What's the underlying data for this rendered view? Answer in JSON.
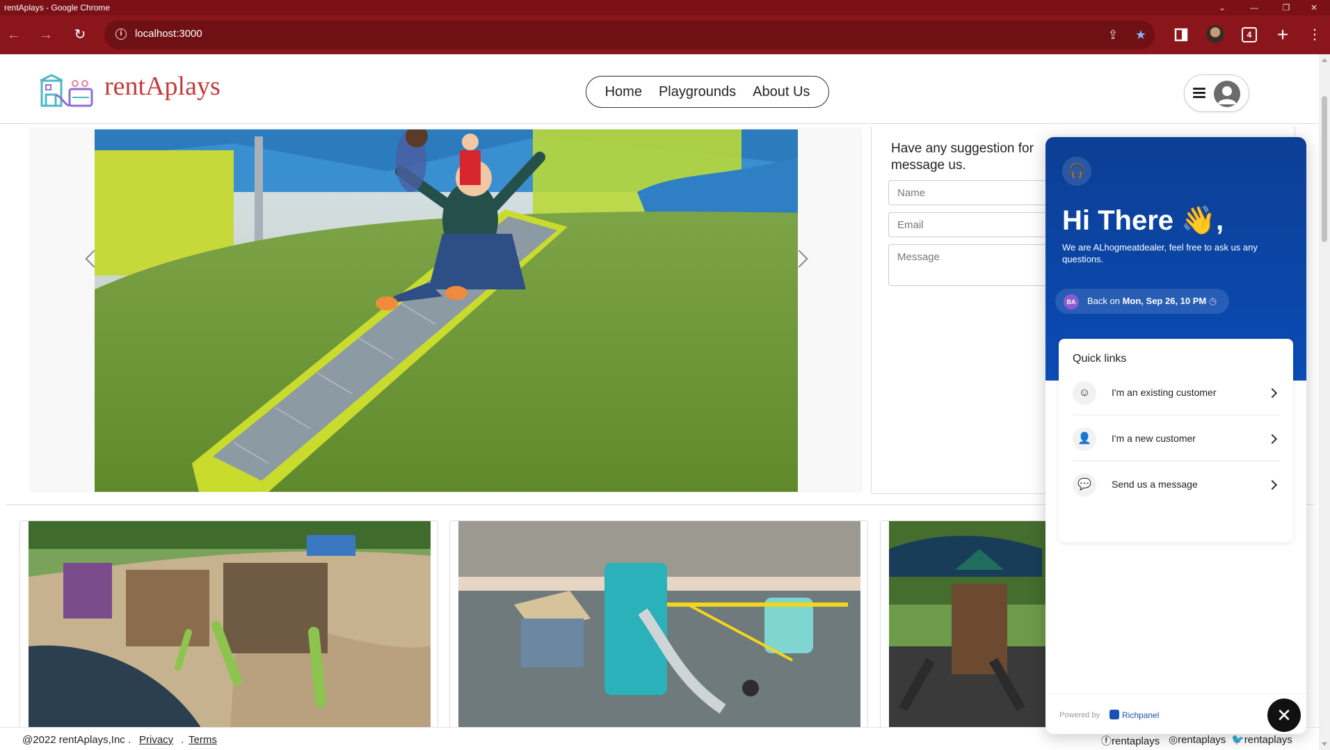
{
  "window": {
    "title": "rentAplays - Google Chrome"
  },
  "browser": {
    "url": "localhost:3000",
    "tab_count": "4"
  },
  "header": {
    "brand": "rentAplays",
    "nav": [
      "Home",
      "Playgrounds",
      "About Us"
    ]
  },
  "contact": {
    "title_line1": "Have any suggestion for",
    "title_line2": "message us.",
    "name_placeholder": "Name",
    "email_placeholder": "Email",
    "message_placeholder": "Message"
  },
  "footer": {
    "copyright": "@2022 rentAplays,Inc .",
    "privacy": "Privacy",
    "terms": "Terms",
    "sep": ".",
    "social": [
      {
        "icon": "facebook-icon",
        "label": "rentaplays"
      },
      {
        "icon": "instagram-icon",
        "label": "rentaplays"
      },
      {
        "icon": "twitter-icon",
        "label": "rentaplays"
      }
    ]
  },
  "chat": {
    "greeting": "Hi There 👋,",
    "subtitle": "We are ALhogmeatdealer, feel free to ask us any questions.",
    "badge": "BA",
    "back_prefix": "Back on ",
    "back_time": "Mon, Sep 26, 10 PM",
    "quick_links_title": "Quick links",
    "quick_links": [
      {
        "icon": "customer-face-icon",
        "label": "I'm an existing customer"
      },
      {
        "icon": "person-icon",
        "label": "I'm a new customer"
      },
      {
        "icon": "message-icon",
        "label": "Send us a message"
      }
    ],
    "powered_by": "Powered by",
    "provider": "Richpanel"
  },
  "colors": {
    "chrome_frame": "#7b1116",
    "chrome_toolbar": "#8a161c",
    "brand": "#c23a3a",
    "chat_blue": "#0a4bb5"
  }
}
